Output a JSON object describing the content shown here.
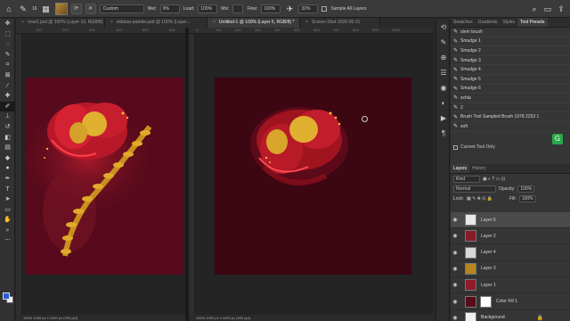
{
  "options_bar": {
    "brush_size": "16",
    "mode": "Custom",
    "wet_label": "Wet:",
    "wet_value": "0%",
    "load_label": "Load:",
    "load_value": "100%",
    "mix_label": "Mix:",
    "flow_label": "Flow:",
    "flow_value": "100%",
    "angle_value": "32%",
    "sample_all_layers": "Sample All Layers"
  },
  "tabs": [
    {
      "label": "rose2.psd @ 100% (Layer 16, RGB/8)",
      "active": false
    },
    {
      "label": "sidebar-palette.psd @ 100% (Layer...",
      "active": false
    },
    {
      "label": "Untitled-1 @ 100% (Layer 5, RGB/8) *",
      "active": true
    },
    {
      "label": "Screen Shot 2020-06-21",
      "active": false
    }
  ],
  "rulers": {
    "a": [
      "100",
      "200",
      "300",
      "400",
      "500",
      "600"
    ],
    "b": [
      "0",
      "100",
      "200",
      "300",
      "400",
      "500",
      "600",
      "700",
      "800",
      "900",
      "1000"
    ]
  },
  "status": {
    "left": "100%   1000 px x 1000 px (300 ppi)",
    "right": "100%   1000 px x 1000 px (300 ppi)"
  },
  "tool_presets": {
    "tabs": [
      "Swatches",
      "Gradients",
      "Styles",
      "Tool Presets"
    ],
    "items": [
      "stem brush",
      "Smudge 1",
      "Smudge 2",
      "Smudge 3",
      "Smudge 4",
      "Smudge 5",
      "Smudge 6",
      "schla",
      "2",
      "Brush Tool Sampled Brush 1978 2253 1",
      "soft"
    ],
    "current_tool_only": "Current Tool Only"
  },
  "layers_panel": {
    "tabs": [
      "Layers",
      "History"
    ],
    "filter": "Kind",
    "blend_mode": "Normal",
    "opacity_label": "Opacity:",
    "opacity_value": "100%",
    "lock_label": "Lock:",
    "fill_label": "Fill:",
    "fill_value": "100%",
    "layers": [
      {
        "name": "Layer 5",
        "active": true,
        "thumb": "#e8e8e8"
      },
      {
        "name": "Layer 2",
        "active": false,
        "thumb": "#8a1a2a"
      },
      {
        "name": "Layer 4",
        "active": false,
        "thumb": "#d8d8d8"
      },
      {
        "name": "Layer 3",
        "active": false,
        "thumb": "#b5851f"
      },
      {
        "name": "Layer 1",
        "active": false,
        "thumb": "#8e1c2c"
      },
      {
        "name": "Color Fill 1",
        "active": false,
        "thumb": "#5a0b1c"
      },
      {
        "name": "Background",
        "active": false,
        "thumb": "#f0f0f0"
      }
    ]
  },
  "colors": {
    "canvas_left": "#560a1c",
    "canvas_right": "#3c0612",
    "foreground": "#2a5bd8"
  }
}
